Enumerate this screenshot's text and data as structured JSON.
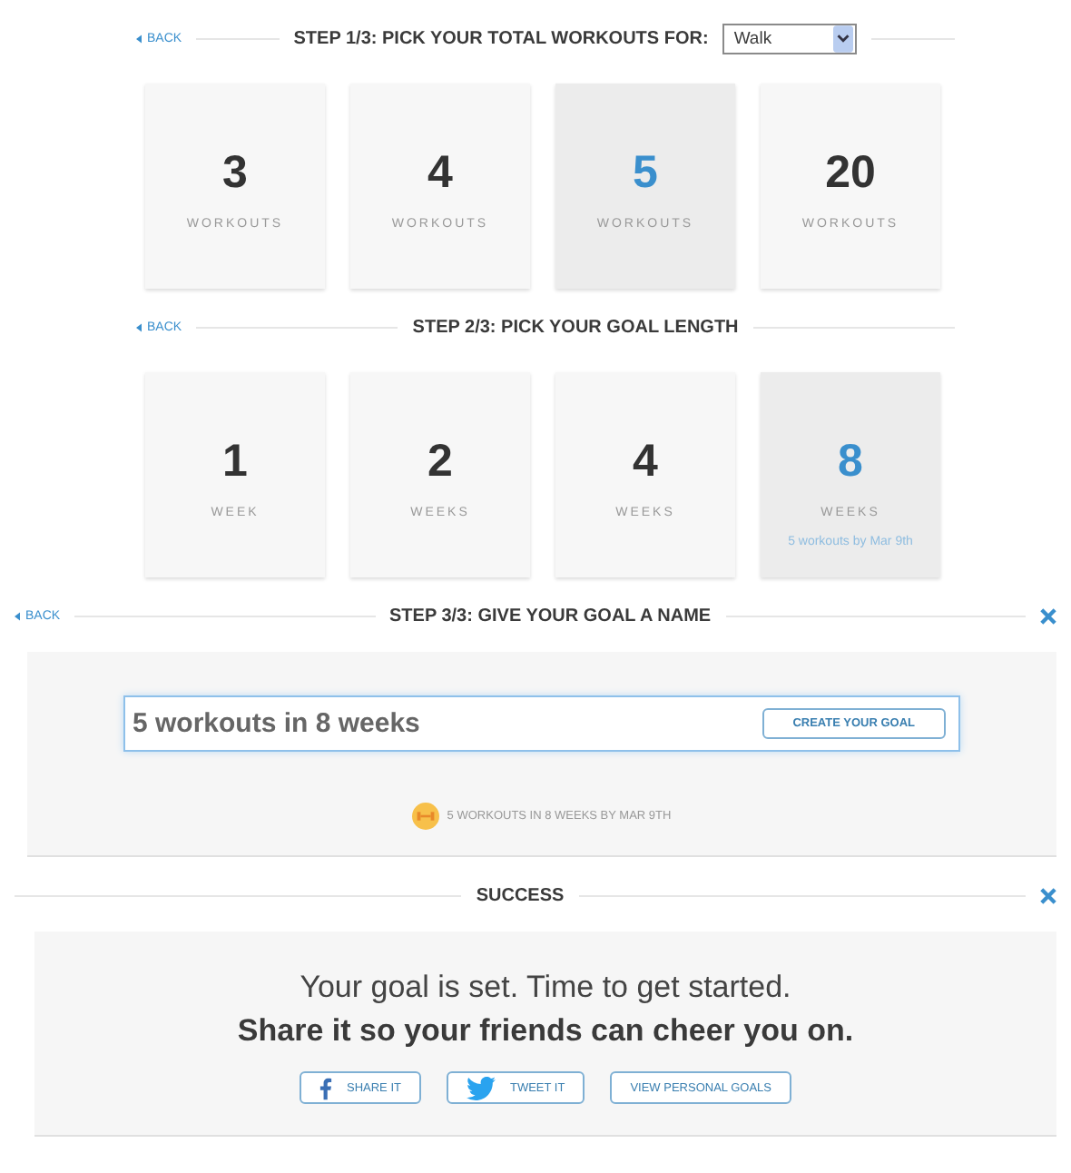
{
  "sections": [
    {
      "kind": "cards",
      "back": "BACK",
      "title": "STEP 1/3: PICK YOUR TOTAL WORKOUTS FOR:",
      "select": {
        "value": "Walk"
      },
      "close": false,
      "options": [
        {
          "value": "3",
          "unit": "WORKOUTS",
          "selected": false
        },
        {
          "value": "4",
          "unit": "WORKOUTS",
          "selected": false
        },
        {
          "value": "5",
          "unit": "WORKOUTS",
          "selected": true
        },
        {
          "value": "20",
          "unit": "WORKOUTS",
          "selected": false
        }
      ]
    },
    {
      "kind": "cards",
      "back": "BACK",
      "title": "STEP 2/3: PICK YOUR GOAL LENGTH",
      "close": false,
      "options": [
        {
          "value": "1",
          "unit": "WEEK",
          "selected": false
        },
        {
          "value": "2",
          "unit": "WEEKS",
          "selected": false
        },
        {
          "value": "4",
          "unit": "WEEKS",
          "selected": false
        },
        {
          "value": "8",
          "unit": "WEEKS",
          "selected": true,
          "note": "5 workouts by Mar 9th"
        }
      ]
    },
    {
      "kind": "name",
      "back": "BACK",
      "title": "STEP 3/3: GIVE YOUR GOAL A NAME",
      "close": true,
      "field": {
        "value": "5 workouts in 8 weeks"
      },
      "button": "CREATE YOUR GOAL",
      "summary": "5 WORKOUTS IN 8 WEEKS BY MAR 9TH"
    },
    {
      "kind": "success",
      "title": "SUCCESS",
      "close": true,
      "line1": "Your goal is set. Time to get started.",
      "line2": "Share it so your friends can cheer you on.",
      "buttons": [
        {
          "kind": "facebook",
          "label": "SHARE IT"
        },
        {
          "kind": "twitter",
          "label": "TWEET IT"
        },
        {
          "kind": "plain",
          "label": "VIEW PERSONAL GOALS"
        }
      ]
    }
  ]
}
